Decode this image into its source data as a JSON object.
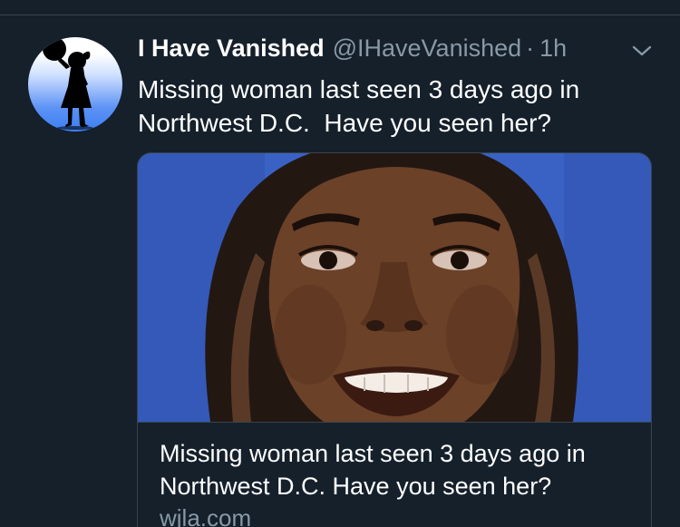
{
  "tweet": {
    "display_name": "I Have Vanished",
    "handle": "@IHaveVanished",
    "separator": "·",
    "time": "1h",
    "text": "Missing woman last seen 3 days ago in Northwest D.C.  Have you seen her?",
    "menu_icon": "chevron-down-icon"
  },
  "card": {
    "title": "Missing woman last seen 3 days ago in Northwest D.C. Have you seen her?",
    "domain": "wjla.com"
  },
  "colors": {
    "background": "#15202b",
    "secondary_text": "#8899a6",
    "border": "#38444d",
    "photo_backdrop": "#3a62c4"
  }
}
